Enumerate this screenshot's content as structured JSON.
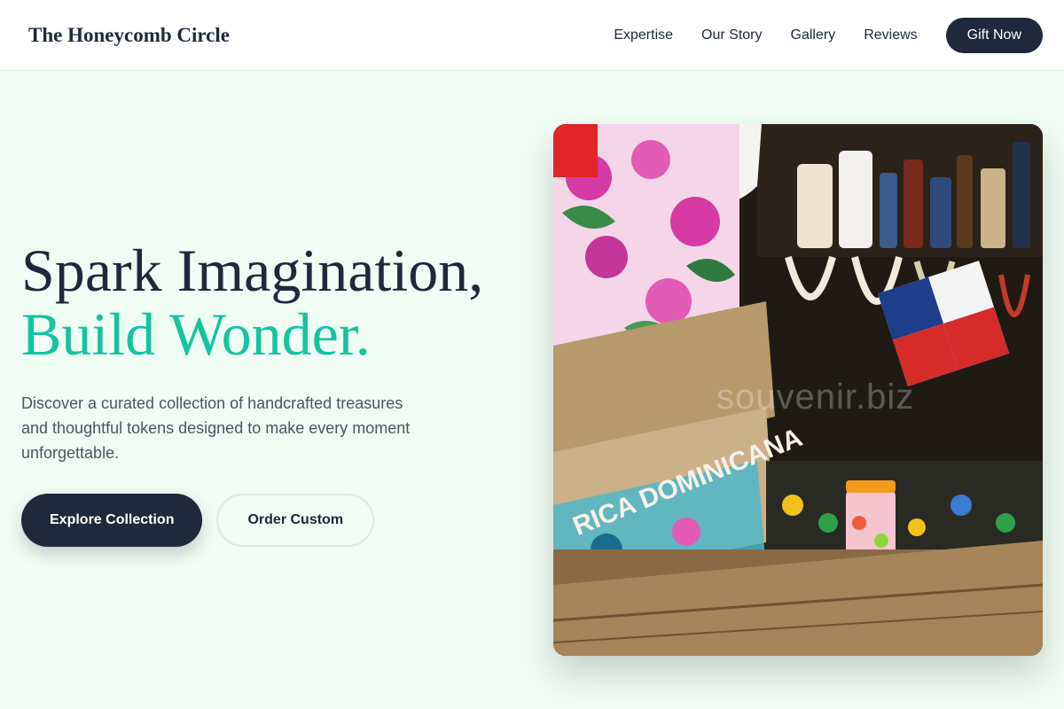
{
  "brand": {
    "name": "The Honeycomb Circle"
  },
  "nav": {
    "links": [
      "Expertise",
      "Our Story",
      "Gallery",
      "Reviews"
    ],
    "cta": "Gift Now"
  },
  "hero": {
    "headline_line1": "Spark Imagination,",
    "headline_line2": "Build Wonder.",
    "subtitle": "Discover a curated collection of handcrafted treasures and thoughtful tokens designed to make every moment unforgettable.",
    "primary_button": "Explore Collection",
    "secondary_button": "Order Custom",
    "image": {
      "description": "market stall with souvenirs",
      "bag_text": "RICA DOMINICANA",
      "watermark": "souvenir.biz"
    }
  },
  "colors": {
    "background": "#f0fdf4",
    "dark": "#1e293b",
    "accent": "#14c4a0",
    "muted_text": "#4b5563"
  }
}
